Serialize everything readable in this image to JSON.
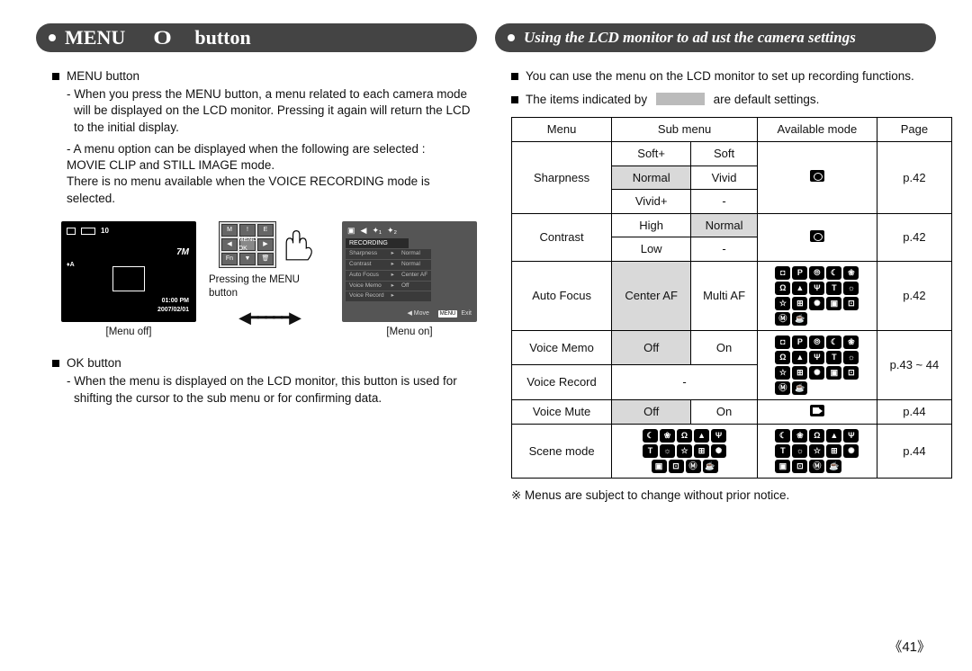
{
  "header_left": {
    "title_a": "MENU",
    "title_b": "O",
    "title_c": "button"
  },
  "header_right": {
    "title": "Using the LCD monitor to ad ust the camera settings"
  },
  "left": {
    "menuBtn": "MENU button",
    "menuPara1": "- When you press the MENU button, a menu related to each camera mode will be displayed on the LCD monitor. Pressing it again will return the LCD to the initial display.",
    "menuPara2a": "- A menu option can be displayed when the following are selected :",
    "menuPara2b": "MOVIE CLIP and STILL IMAGE mode.",
    "menuPara2c": "There is no menu available when the VOICE RECORDING mode is selected.",
    "lcd": {
      "count": "10",
      "seven": "7M",
      "auto": "♦A",
      "time": "01:00 PM",
      "date": "2007/02/01"
    },
    "press_label": "Pressing the MENU button",
    "menu_off": "[Menu off]",
    "menu_on": "[Menu on]",
    "lcd2": {
      "head": "RECORDING",
      "rows": [
        [
          "Sharpness",
          "Normal"
        ],
        [
          "Contrast",
          "Normal"
        ],
        [
          "Auto Focus",
          "Center AF"
        ],
        [
          "Voice Memo",
          "Off"
        ],
        [
          "Voice Record",
          ""
        ]
      ],
      "move": "Move",
      "menu_chip": "MENU",
      "exit": "Exit"
    },
    "okBtn": "OK button",
    "okPara": "- When the menu is displayed on the LCD monitor, this button is used for shifting the cursor to the sub menu or for confirming data."
  },
  "right": {
    "intro1": "You can use the menu on the LCD monitor to set up recording functions.",
    "intro2a": "The items indicated by",
    "intro2b": "are default settings.",
    "th": {
      "menu": "Menu",
      "sub": "Sub menu",
      "mode": "Available mode",
      "page": "Page"
    },
    "sharpness": {
      "name": "Sharpness",
      "softp": "Soft+",
      "soft": "Soft",
      "normal": "Normal",
      "vivid": "Vivid",
      "vividp": "Vivid+",
      "dash": "-",
      "page": "p.42"
    },
    "contrast": {
      "name": "Contrast",
      "high": "High",
      "normal": "Normal",
      "low": "Low",
      "dash": "-",
      "page": "p.42"
    },
    "af": {
      "name": "Auto Focus",
      "center": "Center AF",
      "multi": "Multi AF",
      "page": "p.42"
    },
    "vm": {
      "name": "Voice Memo",
      "off": "Off",
      "on": "On"
    },
    "vr": {
      "name": "Voice Record",
      "dash": "-"
    },
    "vmvr_page": "p.43 ~ 44",
    "mute": {
      "name": "Voice Mute",
      "off": "Off",
      "on": "On",
      "page": "p.44"
    },
    "scene": {
      "name": "Scene mode",
      "page": "p.44"
    },
    "footnote": "※ Menus are subject to change without prior notice."
  },
  "page_number": "《41》"
}
